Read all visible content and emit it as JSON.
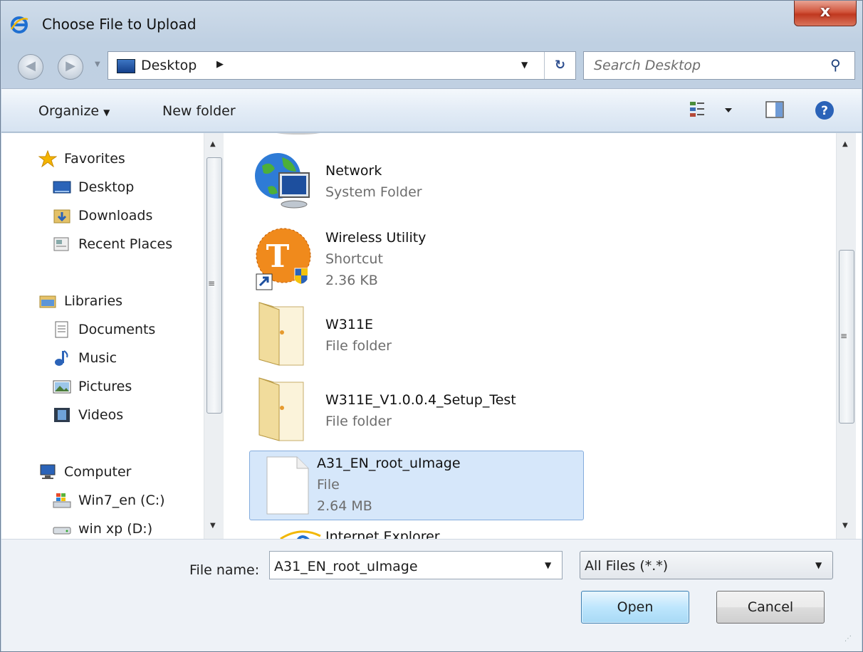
{
  "window": {
    "title": "Choose File to Upload",
    "close_label": "x"
  },
  "address": {
    "location": "Desktop",
    "search_placeholder": "Search Desktop"
  },
  "toolbar": {
    "organize": "Organize",
    "new_folder": "New folder"
  },
  "nav": {
    "favorites": "Favorites",
    "desktop": "Desktop",
    "downloads": "Downloads",
    "recent": "Recent Places",
    "libraries": "Libraries",
    "documents": "Documents",
    "music": "Music",
    "pictures": "Pictures",
    "videos": "Videos",
    "computer": "Computer",
    "drive_c": "Win7_en (C:)",
    "drive_d": "win xp (D:)"
  },
  "files": [
    {
      "name": "Network",
      "line2": "System Folder",
      "line3": ""
    },
    {
      "name": "Wireless Utility",
      "line2": "Shortcut",
      "line3": "2.36 KB"
    },
    {
      "name": "W311E",
      "line2": "File folder",
      "line3": ""
    },
    {
      "name": "W311E_V1.0.0.4_Setup_Test",
      "line2": "File folder",
      "line3": ""
    },
    {
      "name": "A31_EN_root_uImage",
      "line2": "File",
      "line3": "2.64 MB"
    },
    {
      "name": "Internet Explorer",
      "line2": "",
      "line3": ""
    }
  ],
  "bottom": {
    "file_name_label": "File name:",
    "file_name_value": "A31_EN_root_uImage",
    "file_type": "All Files (*.*)",
    "open": "Open",
    "cancel": "Cancel"
  }
}
